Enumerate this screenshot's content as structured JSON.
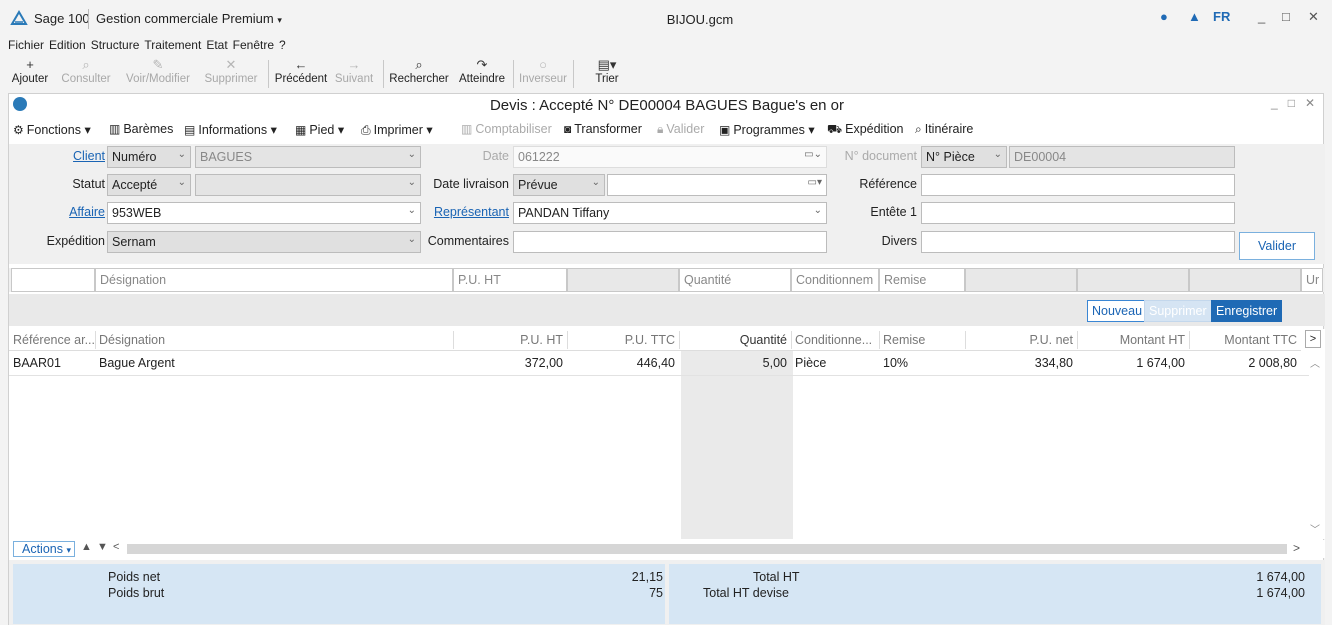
{
  "titlebar": {
    "app": "Sage 100",
    "module": "Gestion commerciale Premium",
    "file": "BIJOU.gcm",
    "lang": "FR"
  },
  "menu": [
    "Fichier",
    "Edition",
    "Structure",
    "Traitement",
    "Etat",
    "Fenêtre",
    "?"
  ],
  "toolbar": {
    "ajouter": "Ajouter",
    "consulter": "Consulter",
    "voir_modifier": "Voir/Modifier",
    "supprimer": "Supprimer",
    "precedent": "Précédent",
    "suivant": "Suivant",
    "rechercher": "Rechercher",
    "atteindre": "Atteindre",
    "inverseur": "Inverseur",
    "trier": "Trier"
  },
  "document": {
    "title": "Devis : Accepté N° DE00004 BAGUES Bague's en or"
  },
  "functions": {
    "fonctions": "Fonctions",
    "baremes": "Barèmes",
    "informations": "Informations",
    "pied": "Pied",
    "imprimer": "Imprimer",
    "comptabiliser": "Comptabiliser",
    "transformer": "Transformer",
    "valider": "Valider",
    "programmes": "Programmes",
    "expedition": "Expédition",
    "itineraire": "Itinéraire"
  },
  "form": {
    "client_label": "Client",
    "client_type": "Numéro",
    "client_value": "BAGUES",
    "date_label": "Date",
    "date_value": "061222",
    "ndoc_label": "N° document",
    "ndoc_type": "N° Pièce",
    "ndoc_value": "DE00004",
    "statut_label": "Statut",
    "statut_value": "Accepté",
    "date_livraison_label": "Date livraison",
    "date_livraison_type": "Prévue",
    "reference_label": "Référence",
    "affaire_label": "Affaire",
    "affaire_value": "953WEB",
    "representant_label": "Représentant",
    "representant_value": "PANDAN Tiffany",
    "entete_label": "Entête 1",
    "expedition_label": "Expédition",
    "expedition_value": "Sernam",
    "commentaires_label": "Commentaires",
    "divers_label": "Divers",
    "valider_button": "Valider"
  },
  "entry": {
    "designation": "Désignation",
    "pu_ht": "P.U. HT",
    "quantite": "Quantité",
    "conditionnement": "Conditionnem",
    "remise": "Remise",
    "last": "Ur"
  },
  "actions": {
    "nouveau": "Nouveau",
    "supprimer": "Supprimer",
    "enregistrer": "Enregistrer"
  },
  "grid": {
    "headers": [
      "Référence ar...",
      "Désignation",
      "P.U. HT",
      "P.U. TTC",
      "Quantité",
      "Conditionne...",
      "Remise",
      "P.U. net",
      "Montant HT",
      "Montant TTC"
    ],
    "rows": [
      [
        "BAAR01",
        "Bague Argent",
        "372,00",
        "446,40",
        "5,00",
        "Pièce",
        "10%",
        "334,80",
        "1 674,00",
        "2 008,80"
      ]
    ]
  },
  "bottom": {
    "actions": "Actions"
  },
  "totals": {
    "poids_net_label": "Poids net",
    "poids_net_value": "21,15",
    "poids_brut_label": "Poids brut",
    "poids_brut_value": "75",
    "total_ht_label": "Total HT",
    "total_ht_value": "1 674,00",
    "total_ht_devise_label": "Total HT devise",
    "total_ht_devise_value": "1 674,00"
  }
}
